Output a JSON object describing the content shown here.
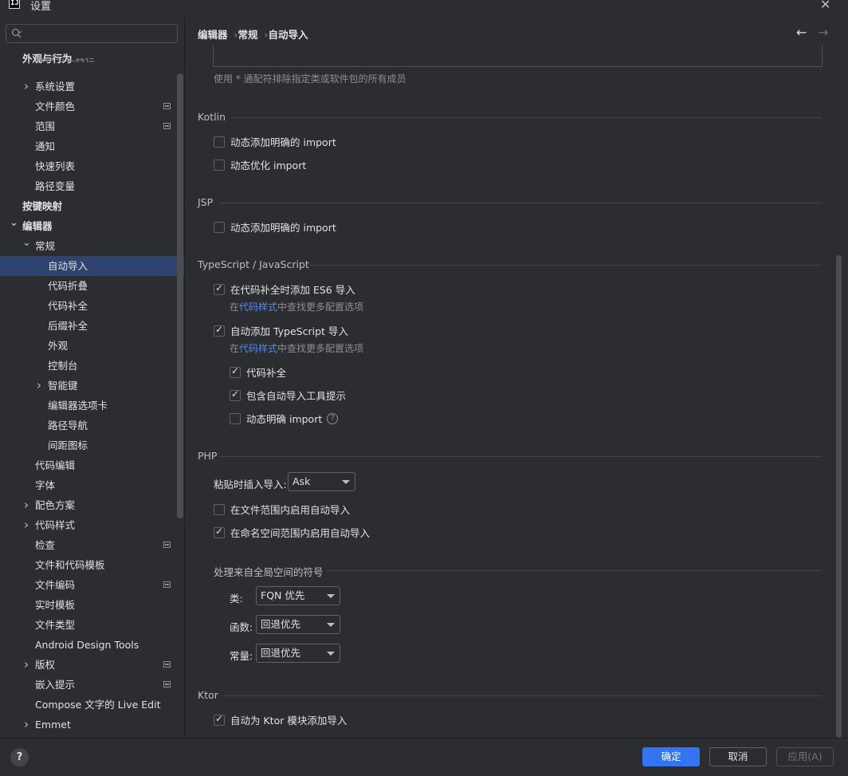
{
  "window": {
    "app_icon_text": "IJ",
    "title": "设置",
    "close": "✕"
  },
  "search": {
    "placeholder": ""
  },
  "sidebar": {
    "items": [
      {
        "label": "外观与行为",
        "level": 0,
        "bold": true
      },
      {
        "label": "菜单与工具栏",
        "level": 1,
        "partial": true
      },
      {
        "label": "系统设置",
        "level": 1,
        "chevron": "right"
      },
      {
        "label": "文件颜色",
        "level": 1,
        "mark": true
      },
      {
        "label": "范围",
        "level": 1,
        "mark": true
      },
      {
        "label": "通知",
        "level": 1
      },
      {
        "label": "快速列表",
        "level": 1
      },
      {
        "label": "路径变量",
        "level": 1
      },
      {
        "label": "按键映射",
        "level": 0,
        "bold": true
      },
      {
        "label": "编辑器",
        "level": 0,
        "bold": true,
        "chevron": "down"
      },
      {
        "label": "常规",
        "level": 1,
        "chevron": "down"
      },
      {
        "label": "自动导入",
        "level": 2,
        "selected": true
      },
      {
        "label": "代码折叠",
        "level": 2
      },
      {
        "label": "代码补全",
        "level": 2
      },
      {
        "label": "后缀补全",
        "level": 2
      },
      {
        "label": "外观",
        "level": 2
      },
      {
        "label": "控制台",
        "level": 2
      },
      {
        "label": "智能键",
        "level": 2,
        "chevron": "right"
      },
      {
        "label": "编辑器选项卡",
        "level": 2
      },
      {
        "label": "路径导航",
        "level": 2
      },
      {
        "label": "间距图标",
        "level": 2
      },
      {
        "label": "代码编辑",
        "level": 1
      },
      {
        "label": "字体",
        "level": 1
      },
      {
        "label": "配色方案",
        "level": 1,
        "chevron": "right"
      },
      {
        "label": "代码样式",
        "level": 1,
        "chevron": "right"
      },
      {
        "label": "检查",
        "level": 1,
        "mark": true
      },
      {
        "label": "文件和代码模板",
        "level": 1
      },
      {
        "label": "文件编码",
        "level": 1,
        "mark": true
      },
      {
        "label": "实时模板",
        "level": 1
      },
      {
        "label": "文件类型",
        "level": 1
      },
      {
        "label": "Android Design Tools",
        "level": 1
      },
      {
        "label": "版权",
        "level": 1,
        "chevron": "right",
        "mark": true
      },
      {
        "label": "嵌入提示",
        "level": 1,
        "mark": true
      },
      {
        "label": "Compose 文字的 Live Edit",
        "level": 1
      },
      {
        "label": "Emmet",
        "level": 1,
        "chevron": "right"
      }
    ]
  },
  "breadcrumb": [
    "编辑器",
    "常规",
    "自动导入"
  ],
  "nav": {
    "back": "←",
    "forward": "→"
  },
  "top_hint": "使用 * 通配符排除指定类或软件包的所有成员",
  "kotlin": {
    "title": "Kotlin",
    "opt1": "动态添加明确的 import",
    "opt2": "动态优化 import"
  },
  "jsp": {
    "title": "JSP",
    "opt1": "动态添加明确的 import"
  },
  "ts": {
    "title": "TypeScript / JavaScript",
    "opt1": "在代码补全时添加 ES6 导入",
    "hint_pre": "在",
    "hint_link": "代码样式",
    "hint_post": "中查找更多配置选项",
    "opt2": "自动添加 TypeScript 导入",
    "sub1": "代码补全",
    "sub2": "包含自动导入工具提示",
    "sub3": "动态明确 import",
    "help": "?"
  },
  "php": {
    "title": "PHP",
    "paste_label": "粘贴时插入导入:",
    "paste_value": "Ask",
    "opt1": "在文件范围内启用自动导入",
    "opt2": "在命名空间范围内启用自动导入",
    "global_title": "处理来自全局空间的符号",
    "class_label": "类:",
    "class_value": "FQN 优先",
    "func_label": "函数:",
    "func_value": "回退优先",
    "const_label": "常量:",
    "const_value": "回退优先"
  },
  "ktor": {
    "title": "Ktor",
    "opt1": "自动为 Ktor 模块添加导入"
  },
  "footer": {
    "help": "?",
    "ok": "确定",
    "cancel": "取消",
    "apply": "应用(A)"
  }
}
